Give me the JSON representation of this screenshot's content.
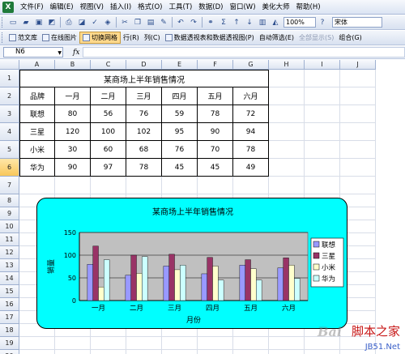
{
  "menu": {
    "items": [
      "文件(F)",
      "编辑(E)",
      "视图(V)",
      "插入(I)",
      "格式(O)",
      "工具(T)",
      "数据(D)",
      "窗口(W)",
      "美化大师",
      "帮助(H)"
    ]
  },
  "toolbar1": {
    "zoom": "100%",
    "font": "宋体"
  },
  "toolbar2": {
    "items": [
      "范文库",
      "在线图片",
      "切换网格",
      "行(R)",
      "列(C)",
      "数据透视表和数据透视图(P)",
      "自动筛选(E)",
      "全部显示(S)",
      "组合(G)"
    ],
    "active_item": "切换网格"
  },
  "formula_bar": {
    "name_box": "N6",
    "fx_label": "fx",
    "formula": ""
  },
  "columns": [
    "A",
    "B",
    "C",
    "D",
    "E",
    "F",
    "G",
    "H",
    "I",
    "J"
  ],
  "selected_column": "",
  "selected_row": "6",
  "rows": [
    "1",
    "2",
    "3",
    "4",
    "5",
    "6",
    "7",
    "8",
    "9",
    "10",
    "11",
    "12",
    "13",
    "14",
    "15",
    "16",
    "17",
    "18",
    "19",
    "20"
  ],
  "sheet": {
    "title": "某商场上半年销售情况",
    "header": [
      "品牌",
      "一月",
      "二月",
      "三月",
      "四月",
      "五月",
      "六月"
    ],
    "data": [
      [
        "联想",
        "80",
        "56",
        "76",
        "59",
        "78",
        "72"
      ],
      [
        "三星",
        "120",
        "100",
        "102",
        "95",
        "90",
        "94"
      ],
      [
        "小米",
        "30",
        "60",
        "68",
        "76",
        "70",
        "78"
      ],
      [
        "华为",
        "90",
        "97",
        "78",
        "45",
        "45",
        "49"
      ]
    ]
  },
  "chart_data": {
    "type": "bar",
    "title": "某商场上半年销售情况",
    "xlabel": "月份",
    "ylabel": "销量",
    "categories": [
      "一月",
      "二月",
      "三月",
      "四月",
      "五月",
      "六月"
    ],
    "series": [
      {
        "name": "联想",
        "values": [
          80,
          56,
          76,
          59,
          78,
          72
        ],
        "color": "#9999ff"
      },
      {
        "name": "三星",
        "values": [
          120,
          100,
          102,
          95,
          90,
          94
        ],
        "color": "#993366"
      },
      {
        "name": "小米",
        "values": [
          30,
          60,
          68,
          76,
          70,
          78
        ],
        "color": "#ffffcc"
      },
      {
        "name": "华为",
        "values": [
          90,
          97,
          78,
          45,
          45,
          49
        ],
        "color": "#ccffff"
      }
    ],
    "yticks": [
      0,
      50,
      100,
      150
    ],
    "ylim": [
      0,
      150
    ],
    "legend": "right",
    "plot_bg": "#c0c0c0",
    "chart_bg": "#00ffff",
    "grid": true
  },
  "watermark": {
    "baidu": "Bai",
    "brand": "脚本之家",
    "site": "JB51.Net"
  }
}
